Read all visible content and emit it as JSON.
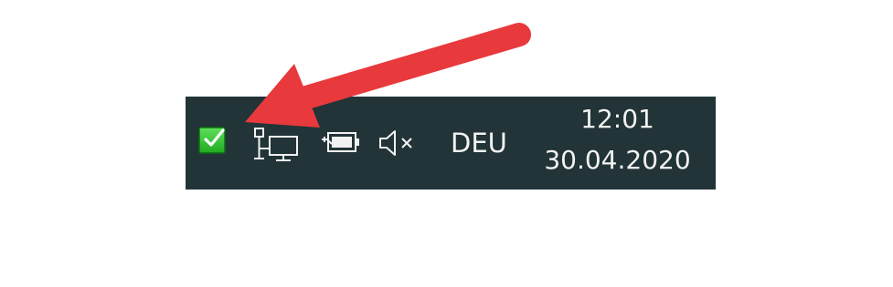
{
  "taskbar": {
    "tray": {
      "icons": [
        {
          "name": "green-check-app-icon",
          "color": "#33c833"
        },
        {
          "name": "network-icon"
        },
        {
          "name": "battery-charging-icon"
        },
        {
          "name": "volume-muted-icon"
        }
      ],
      "language": "DEU",
      "clock": {
        "time": "12:01",
        "date": "30.04.2020"
      }
    },
    "background_color": "#223437"
  },
  "annotation": {
    "arrow_color": "#e8393d"
  }
}
